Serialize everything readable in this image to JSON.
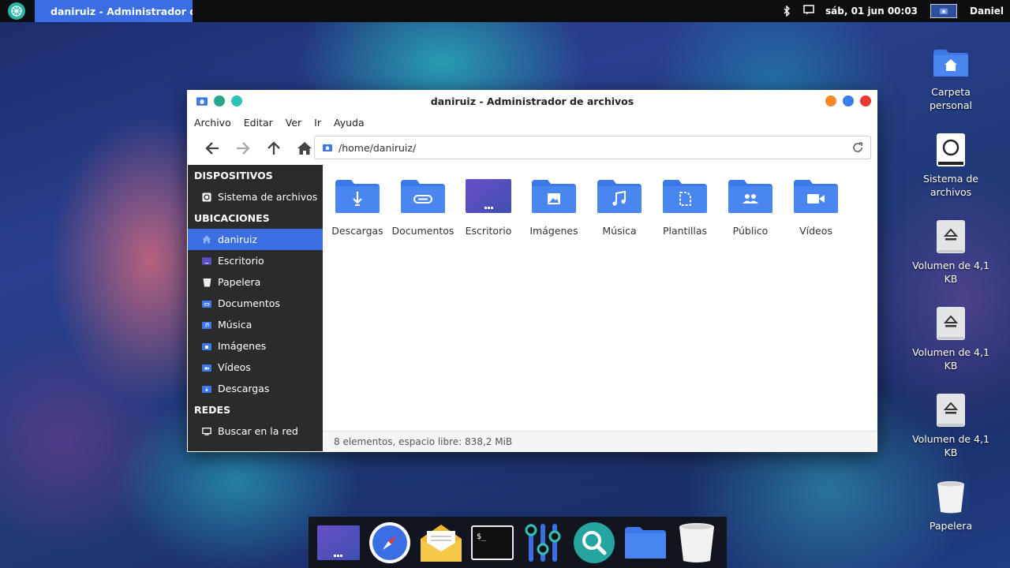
{
  "top_panel": {
    "task_title": "daniruiz - Administrador d...",
    "clock": "sáb, 01 jun 00:03",
    "user": "Daniel"
  },
  "window": {
    "title": "daniruiz - Administrador de archivos",
    "menu": [
      "Archivo",
      "Editar",
      "Ver",
      "Ir",
      "Ayuda"
    ],
    "location": "/home/daniruiz/",
    "sidebar": {
      "sections": [
        {
          "heading": "DISPOSITIVOS",
          "items": [
            {
              "label": "Sistema de archivos",
              "icon": "drive-icon"
            }
          ]
        },
        {
          "heading": "UBICACIONES",
          "items": [
            {
              "label": "daniruiz",
              "icon": "home-icon"
            },
            {
              "label": "Escritorio",
              "icon": "desktop-icon"
            },
            {
              "label": "Papelera",
              "icon": "trash-icon"
            },
            {
              "label": "Documentos",
              "icon": "documents-icon"
            },
            {
              "label": "Música",
              "icon": "music-icon"
            },
            {
              "label": "Imágenes",
              "icon": "images-icon"
            },
            {
              "label": "Vídeos",
              "icon": "videos-icon"
            },
            {
              "label": "Descargas",
              "icon": "downloads-icon"
            }
          ]
        },
        {
          "heading": "REDES",
          "items": [
            {
              "label": "Buscar en la red",
              "icon": "network-icon"
            }
          ]
        }
      ]
    },
    "files": [
      {
        "label": "Descargas",
        "icon": "downloads-folder-icon"
      },
      {
        "label": "Documentos",
        "icon": "documents-folder-icon"
      },
      {
        "label": "Escritorio",
        "icon": "desktop-folder-icon"
      },
      {
        "label": "Imágenes",
        "icon": "images-folder-icon"
      },
      {
        "label": "Música",
        "icon": "music-folder-icon"
      },
      {
        "label": "Plantillas",
        "icon": "templates-folder-icon"
      },
      {
        "label": "Público",
        "icon": "public-folder-icon"
      },
      {
        "label": "Vídeos",
        "icon": "videos-folder-icon"
      }
    ],
    "status": "8 elementos, espacio libre: 838,2 MiB"
  },
  "desktop_icons": [
    {
      "label": "Carpeta personal",
      "icon": "home-folder-icon"
    },
    {
      "label": "Sistema de archivos",
      "icon": "drive-icon"
    },
    {
      "label": "Volumen de 4,1 KB",
      "icon": "eject-icon"
    },
    {
      "label": "Volumen de 4,1 KB",
      "icon": "eject-icon"
    },
    {
      "label": "Volumen de 4,1 KB",
      "icon": "eject-icon"
    },
    {
      "label": "Papelera",
      "icon": "trash-icon"
    }
  ],
  "dock": [
    "desktop-icon",
    "compass-browser-icon",
    "mail-icon",
    "terminal-icon",
    "settings-sliders-icon",
    "search-icon",
    "folder-icon",
    "trash-icon"
  ],
  "colors": {
    "accent": "#3b6ee3",
    "folder": "#3d78e8",
    "sidebar_bg": "#2b2b2e",
    "close": "#e53935",
    "maximize": "#3b7ee8",
    "minimize": "#f28c28",
    "teal": "#2ab3a6"
  }
}
